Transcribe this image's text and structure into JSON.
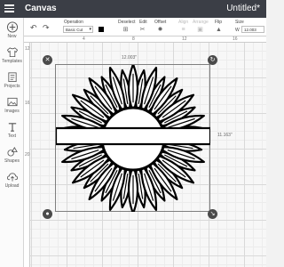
{
  "header": {
    "app_title": "Canvas",
    "doc_title": "Untitled*"
  },
  "toolbar": {
    "operation_label": "Operation",
    "operation_value": "Basic Cut",
    "deselect_label": "Deselect",
    "edit_label": "Edit",
    "offset_label": "Offset",
    "align_label": "Align",
    "arrange_label": "Arrange",
    "flip_label": "Flip",
    "size_label": "Size",
    "size_w_label": "W",
    "size_w_value": "12.003"
  },
  "sidebar": {
    "items": [
      {
        "label": "New",
        "icon": "plus-icon"
      },
      {
        "label": "Templates",
        "icon": "shirt-icon"
      },
      {
        "label": "Projects",
        "icon": "projects-icon"
      },
      {
        "label": "Images",
        "icon": "image-icon"
      },
      {
        "label": "Text",
        "icon": "text-icon"
      },
      {
        "label": "Shapes",
        "icon": "shapes-icon"
      },
      {
        "label": "Upload",
        "icon": "upload-icon"
      }
    ]
  },
  "ruler": {
    "top": [
      "4",
      "8",
      "12",
      "16"
    ],
    "left": [
      "12",
      "16",
      "20"
    ]
  },
  "selection": {
    "width_label": "12.003\"",
    "height_label": "11.163\""
  },
  "colors": {
    "header_bg": "#3b3e46",
    "line_color": "#000000"
  }
}
